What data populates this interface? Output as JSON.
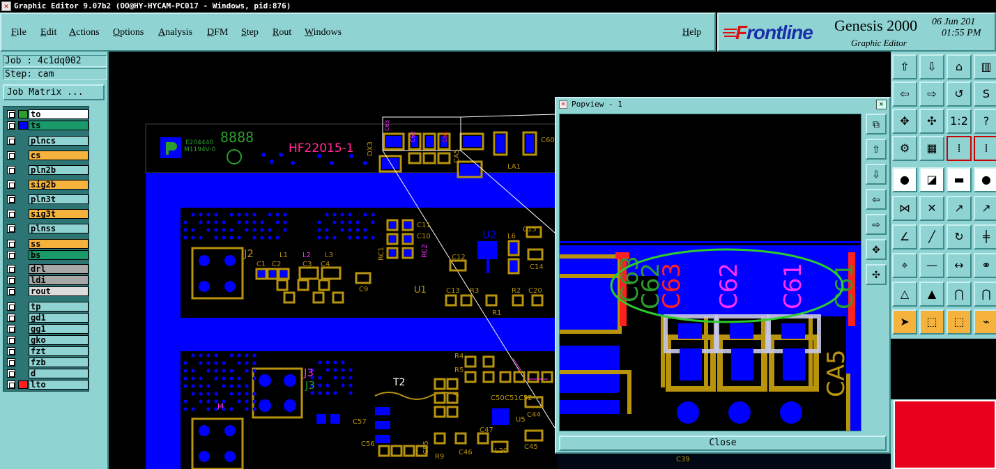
{
  "window": {
    "title": "Graphic Editor 9.07b2 (OO@HY-HYCAM-PC017 - Windows, pid:876)"
  },
  "menu": {
    "items": [
      {
        "label": "File",
        "ul": "F",
        "rest": "ile"
      },
      {
        "label": "Edit",
        "ul": "E",
        "rest": "dit"
      },
      {
        "label": "Actions",
        "ul": "A",
        "rest": "ctions"
      },
      {
        "label": "Options",
        "ul": "O",
        "rest": "ptions"
      },
      {
        "label": "Analysis",
        "ul": "A",
        "rest": "nalysis"
      },
      {
        "label": "DFM",
        "ul": "D",
        "rest": "FM"
      },
      {
        "label": "Step",
        "ul": "S",
        "rest": "tep"
      },
      {
        "label": "Rout",
        "ul": "R",
        "rest": "out"
      },
      {
        "label": "Windows",
        "ul": "W",
        "rest": "indows"
      }
    ],
    "help": {
      "ul": "H",
      "rest": "elp"
    }
  },
  "brand": {
    "logo_f": "F",
    "logo_rest": "rontline",
    "product": "Genesis 2000",
    "subtitle": "Graphic Editor",
    "date": "06 Jun 201",
    "time": "01:55 PM"
  },
  "job": {
    "job_label": "Job : 4c1dq002",
    "step_label": "Step: cam",
    "matrix_button": "Job Matrix ..."
  },
  "layers": [
    {
      "name": "to",
      "bg": "#ffffff",
      "swatch": "#2e9c2e",
      "checked": true
    },
    {
      "name": "ts",
      "bg": "#1a9a6a",
      "swatch": "#0000ff",
      "checked": false
    },
    {
      "name": "plncs",
      "bg": "#8fd3d3",
      "swatch": "",
      "checked": false
    },
    {
      "name": "cs",
      "bg": "#f5b23c",
      "swatch": "",
      "checked": false
    },
    {
      "name": "pln2b",
      "bg": "#8fd3d3",
      "swatch": "",
      "checked": false
    },
    {
      "name": "sig2b",
      "bg": "#f5b23c",
      "swatch": "",
      "checked": false
    },
    {
      "name": "pln3t",
      "bg": "#8fd3d3",
      "swatch": "",
      "checked": false
    },
    {
      "name": "sig3t",
      "bg": "#f5b23c",
      "swatch": "",
      "checked": false
    },
    {
      "name": "plnss",
      "bg": "#8fd3d3",
      "swatch": "",
      "checked": false
    },
    {
      "name": "ss",
      "bg": "#f5b23c",
      "swatch": "",
      "checked": false
    },
    {
      "name": "bs",
      "bg": "#1a9a6a",
      "swatch": "",
      "checked": false
    },
    {
      "name": "drl",
      "bg": "#a8a8a8",
      "swatch": "",
      "checked": false
    },
    {
      "name": "ldi",
      "bg": "#a8a8a8",
      "swatch": "",
      "checked": false
    },
    {
      "name": "rout",
      "bg": "#dcdcdc",
      "swatch": "",
      "checked": false
    },
    {
      "name": "tp",
      "bg": "#8fd3d3",
      "swatch": "",
      "checked": false
    },
    {
      "name": "gd1",
      "bg": "#8fd3d3",
      "swatch": "",
      "checked": false
    },
    {
      "name": "gg1",
      "bg": "#8fd3d3",
      "swatch": "",
      "checked": false
    },
    {
      "name": "gko",
      "bg": "#8fd3d3",
      "swatch": "",
      "checked": false
    },
    {
      "name": "fzt",
      "bg": "#8fd3d3",
      "swatch": "",
      "checked": false
    },
    {
      "name": "fzb",
      "bg": "#8fd3d3",
      "swatch": "",
      "checked": false
    },
    {
      "name": "d",
      "bg": "#8fd3d3",
      "swatch": "",
      "checked": false
    },
    {
      "name": "lto",
      "bg": "#8fd3d3",
      "swatch": "#ff2020",
      "checked": false
    }
  ],
  "board": {
    "marking": "HF22015-1",
    "ul_code": "E204440",
    "ul_rating": "M1194V-0",
    "date_code": "8888",
    "ref_labels": [
      "DX3",
      "C63",
      "C62",
      "C61",
      "CA5",
      "LA1",
      "C60",
      "J2",
      "L1",
      "L2",
      "L3",
      "C1",
      "C2",
      "C3",
      "C4",
      "C9",
      "C11",
      "C10",
      "RC1",
      "RC2",
      "U2",
      "L6",
      "C15",
      "C12",
      "C14",
      "U1",
      "C13",
      "R3",
      "R2",
      "C20",
      "R1",
      "J3",
      "T2",
      "R4",
      "R5",
      "C50",
      "C51",
      "C52",
      "C44",
      "U5",
      "C47",
      "C45",
      "C46",
      "L20",
      "C55",
      "C56",
      "C57",
      "R9",
      "J4",
      "C39"
    ]
  },
  "popview": {
    "title": "Popview - 1",
    "close_x": "×",
    "close_button": "Close",
    "labels": {
      "c63_a": "C63",
      "c62_a": "C62",
      "c63_b": "C63",
      "c62_b": "C62",
      "c61_a": "C61",
      "c61_b": "C61",
      "ca5": "CA5"
    }
  },
  "colors": {
    "panel": "#8fd3d3",
    "copper": "#0000ff",
    "pad_gold": "#b8930c",
    "silk_green": "#2e9c2e",
    "silk_magenta": "#ff30ff",
    "silk_red": "#ff2020"
  }
}
